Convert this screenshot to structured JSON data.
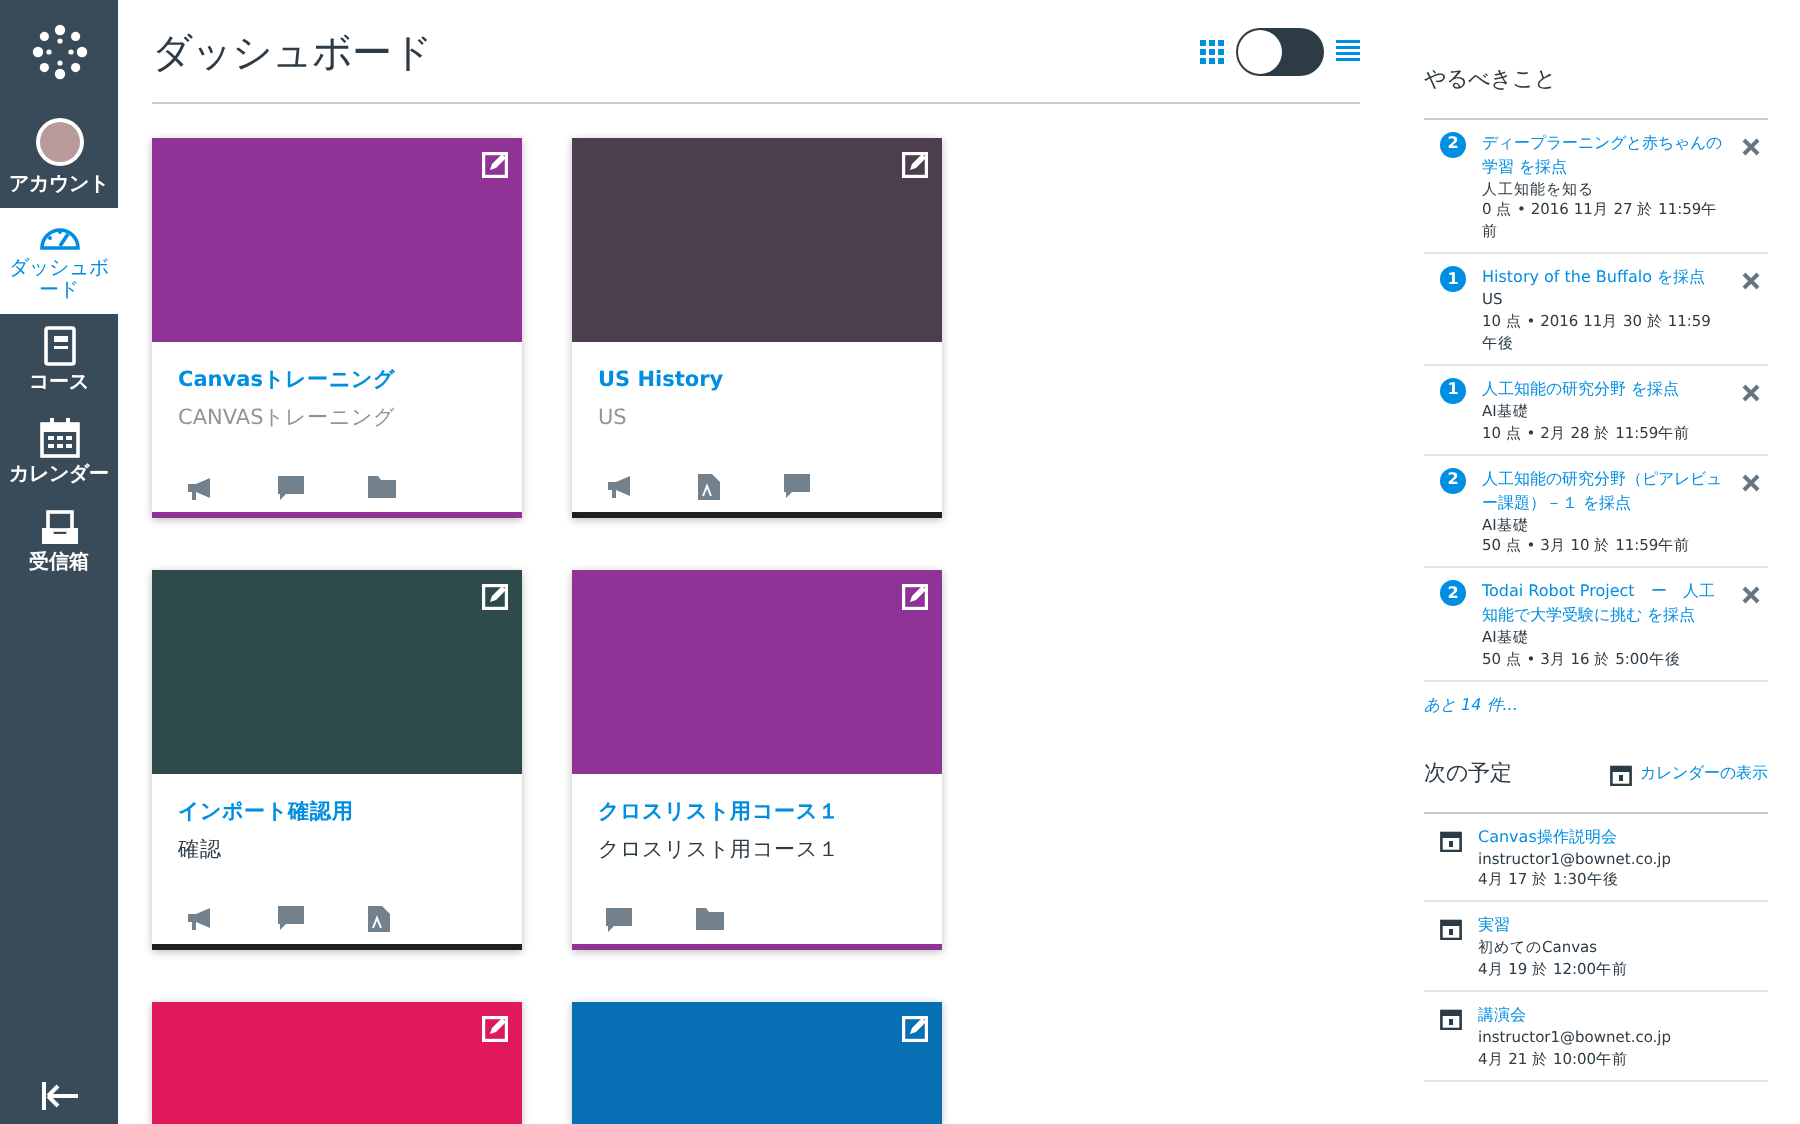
{
  "sidebar": {
    "items": [
      {
        "kind": "account",
        "label": "アカウント",
        "selected": false
      },
      {
        "kind": "dashboard",
        "label": "ダッシュボード",
        "selected": true
      },
      {
        "kind": "courses",
        "label": "コース",
        "selected": false
      },
      {
        "kind": "calendar",
        "label": "カレンダー",
        "selected": false
      },
      {
        "kind": "inbox",
        "label": "受信箱",
        "selected": false
      }
    ]
  },
  "header": {
    "title": "ダッシュボード",
    "card_view": true
  },
  "cards": [
    {
      "color": "#8f3397",
      "accent_bar": {
        "color": "#8f3397"
      },
      "title": "Canvasトレーニング",
      "subtitle": "CANVASトレーニング",
      "subtitle_muted": true,
      "icons": [
        {
          "kind": "announcement"
        },
        {
          "kind": "discussion"
        },
        {
          "kind": "files"
        }
      ]
    },
    {
      "color": "#4d3e4e",
      "accent_bar": {
        "color": "#1f1f1f"
      },
      "title": "US History",
      "subtitle": "US",
      "subtitle_muted": true,
      "icons": [
        {
          "kind": "announcement"
        },
        {
          "kind": "assignment"
        },
        {
          "kind": "discussion"
        }
      ]
    },
    {
      "color": "#2e4a4a",
      "accent_bar": {
        "color": "#1f1f1f"
      },
      "title": "インポート確認用",
      "subtitle": "確認",
      "subtitle_muted": false,
      "icons": [
        {
          "kind": "announcement"
        },
        {
          "kind": "discussion"
        },
        {
          "kind": "assignment"
        }
      ]
    },
    {
      "color": "#8f3397",
      "accent_bar": {
        "color": "#8f3397"
      },
      "title": "クロスリスト用コース１",
      "subtitle": "クロスリスト用コース１",
      "subtitle_muted": false,
      "icons": [
        {
          "kind": "discussion"
        },
        {
          "kind": "files"
        }
      ]
    },
    {
      "color": "#e0195a"
    },
    {
      "color": "#0770b5"
    }
  ],
  "todo": {
    "title": "やるべきこと",
    "items": [
      {
        "count": "2",
        "title": "ディープラーニングと赤ちゃんの学習 を採点",
        "course": "人工知能を知る",
        "details": "0 点 • 2016 11月 27 於 11:59午前"
      },
      {
        "count": "1",
        "title": "History of the Buffalo を採点",
        "course": "US",
        "details": "10 点 • 2016 11月 30 於 11:59午後"
      },
      {
        "count": "1",
        "title": "人工知能の研究分野 を採点",
        "course": "AI基礎",
        "details": "10 点 • 2月 28 於 11:59午前"
      },
      {
        "count": "2",
        "title": "人工知能の研究分野（ピアレビュー課題）－１ を採点",
        "course": "AI基礎",
        "details": "50 点 • 3月 10 於 11:59午前"
      },
      {
        "count": "2",
        "title": "Todai Robot Project　ー　人工知能で大学受験に挑む を採点",
        "course": "AI基礎",
        "details": "50 点 • 3月 16 於 5:00午後"
      }
    ],
    "more": "あと 14 件..."
  },
  "upcoming": {
    "title": "次の予定",
    "calendar_link": "カレンダーの表示",
    "items": [
      {
        "title": "Canvas操作説明会",
        "detail": "instructor1@bownet.co.jp",
        "date": "4月 17 於 1:30午後"
      },
      {
        "title": "実習",
        "detail": "初めてのCanvas",
        "date": "4月 19 於 12:00午前"
      },
      {
        "title": "講演会",
        "detail": "instructor1@bownet.co.jp",
        "date": "4月 21 於 10:00午前"
      }
    ]
  }
}
